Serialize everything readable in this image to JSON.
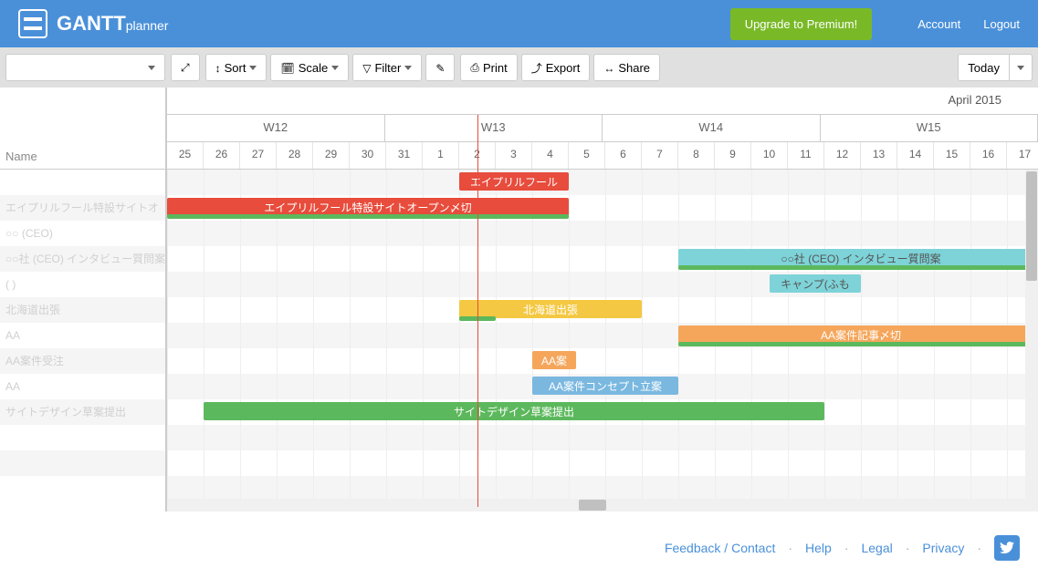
{
  "header": {
    "brand_main": "GANTT",
    "brand_sub": "planner",
    "upgrade": "Upgrade to Premium!",
    "account": "Account",
    "logout": "Logout"
  },
  "toolbar": {
    "sort": "Sort",
    "scale": "Scale",
    "filter": "Filter",
    "print": "Print",
    "export": "Export",
    "share": "Share",
    "today": "Today"
  },
  "left": {
    "name_col": "Name",
    "tasks": [
      "",
      "エイプリルフール特設サイトオ",
      "○○ (CEO)",
      "○○社 (CEO) インタビュー質問案",
      "(         )",
      "北海道出張",
      "AA",
      "AA案件受注",
      "AA",
      "サイトデザイン草案提出",
      "",
      "",
      ""
    ]
  },
  "timeline": {
    "month": "April 2015",
    "weeks": [
      "W12",
      "W13",
      "W14",
      "W15"
    ],
    "days": [
      25,
      26,
      27,
      28,
      29,
      30,
      31,
      1,
      2,
      3,
      4,
      5,
      6,
      7,
      8,
      9,
      10,
      11,
      12,
      13,
      14,
      15,
      16,
      17
    ],
    "today_index": 8
  },
  "chart_data": {
    "type": "gantt",
    "day_width": 40,
    "bars": [
      {
        "row": 0,
        "start": 8,
        "len": 3,
        "color": "red",
        "label": "エイプリルフール"
      },
      {
        "row": 1,
        "start": 0,
        "len": 11,
        "color": "red",
        "label": "エイプリルフール特設サイトオープン〆切"
      },
      {
        "row": 1,
        "start": 0,
        "len": 11,
        "sub": true
      },
      {
        "row": 3,
        "start": 14,
        "len": 10,
        "color": "teal",
        "label": "○○社 (CEO) インタビュー質問案"
      },
      {
        "row": 3,
        "start": 14,
        "len": 10,
        "sub": true
      },
      {
        "row": 4,
        "start": 16.5,
        "len": 2.5,
        "color": "teal",
        "label": "キャンプ(ふも"
      },
      {
        "row": 5,
        "start": 8,
        "len": 5,
        "color": "yellow",
        "label": "北海道出張"
      },
      {
        "row": 5,
        "start": 8,
        "len": 1,
        "sub": true
      },
      {
        "row": 6,
        "start": 14,
        "len": 10,
        "color": "orange",
        "label": "AA案件記事〆切"
      },
      {
        "row": 6,
        "start": 14,
        "len": 10,
        "sub": true
      },
      {
        "row": 7,
        "start": 10,
        "len": 1.2,
        "color": "orange",
        "label": "AA案"
      },
      {
        "row": 8,
        "start": 10,
        "len": 4,
        "color": "lightblue",
        "label": "AA案件コンセプト立案"
      },
      {
        "row": 9,
        "start": 1,
        "len": 17,
        "color": "green",
        "label": "サイトデザイン草案提出"
      }
    ]
  },
  "footer": {
    "feedback": "Feedback / Contact",
    "help": "Help",
    "legal": "Legal",
    "privacy": "Privacy"
  }
}
